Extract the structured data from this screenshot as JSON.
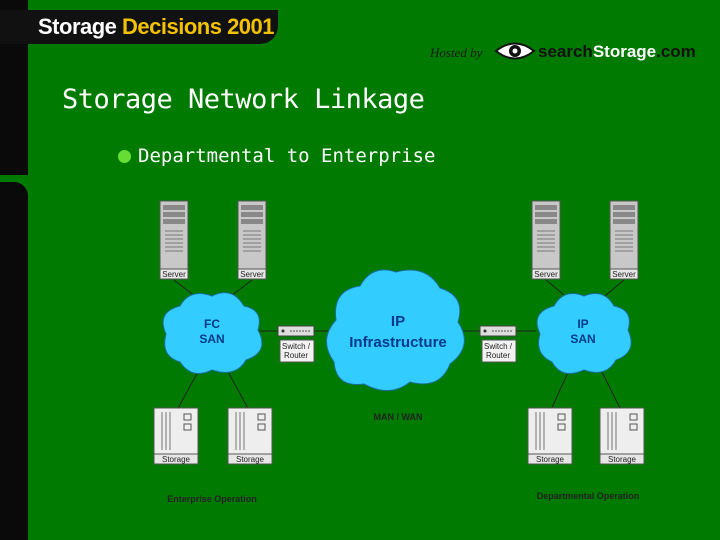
{
  "header": {
    "logo_part1": "Storage ",
    "logo_part2": "Decisions 2001",
    "hosted_by": "Hosted by",
    "brand_search": "search",
    "brand_storage": "Storage",
    "brand_com": ".com"
  },
  "title": "Storage Network Linkage",
  "bullet": "Departmental to Enterprise",
  "diagram": {
    "left_cloud": [
      "FC",
      "SAN"
    ],
    "center_cloud": [
      "IP",
      "Infrastructure"
    ],
    "right_cloud": [
      "IP",
      "SAN"
    ],
    "server_label": "Server",
    "storage_label": "Storage",
    "switch_label": [
      "Switch /",
      "Router"
    ],
    "man_wan": "MAN / WAN",
    "left_caption": "Enterprise Operation",
    "right_caption": "Departmental Operation"
  },
  "colors": {
    "background": "#007a00",
    "cloud": "#33ccff",
    "cloud_text": "#003a88",
    "logo_accent": "#f2c200"
  }
}
